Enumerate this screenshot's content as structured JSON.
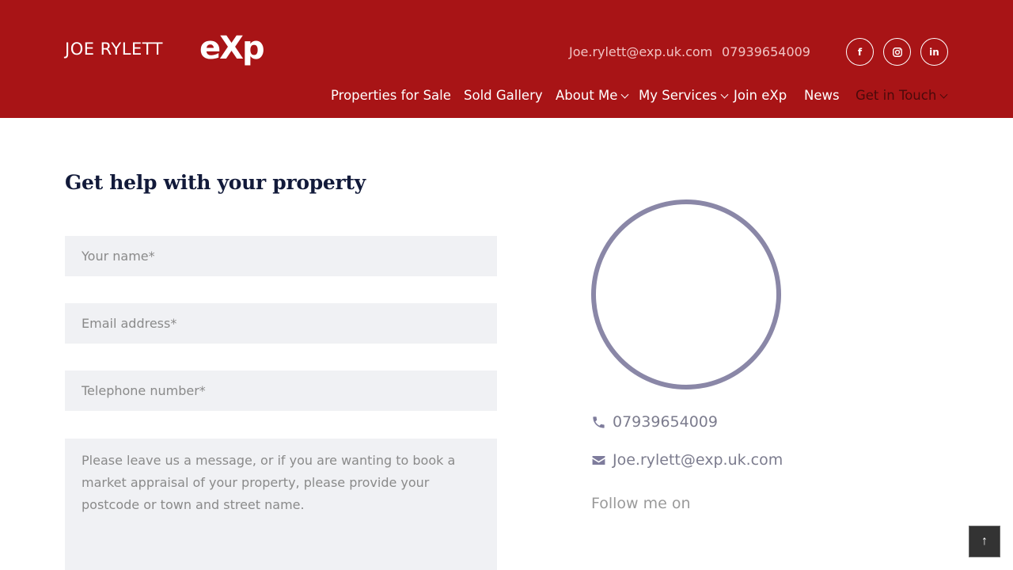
{
  "header": {
    "brand": "JOE RYLETT",
    "logo": "eXp",
    "email": "Joe.rylett@exp.uk.com",
    "phone": "07939654009",
    "social": [
      {
        "icon": "facebook-icon",
        "label": "f"
      },
      {
        "icon": "instagram-icon",
        "label": ""
      },
      {
        "icon": "linkedin-icon",
        "label": "in"
      }
    ]
  },
  "nav": {
    "items": [
      {
        "label": "Properties for Sale"
      },
      {
        "label": "Sold Gallery"
      },
      {
        "label": "About Me"
      },
      {
        "label": "My Services"
      },
      {
        "label": "Join eXp"
      },
      {
        "label": "News"
      },
      {
        "label": "Get in Touch"
      }
    ]
  },
  "form": {
    "title": "Get help with your property",
    "name_placeholder": "Your name*",
    "email_placeholder": "Email address*",
    "tel_placeholder": "Telephone number*",
    "message_placeholder": "Please leave us a message, or if you are wanting to book a market appraisal of your property, please provide your postcode or town and street name."
  },
  "sidebar": {
    "phone": "07939654009",
    "email": "Joe.rylett@exp.uk.com",
    "follow_label": "Follow me on"
  },
  "back_to_top": "↑",
  "colors": {
    "header_bg": "#a81416",
    "title": "#121a3a",
    "field_bg": "#f0f1f4",
    "avatar_ring": "#8a87a7"
  }
}
